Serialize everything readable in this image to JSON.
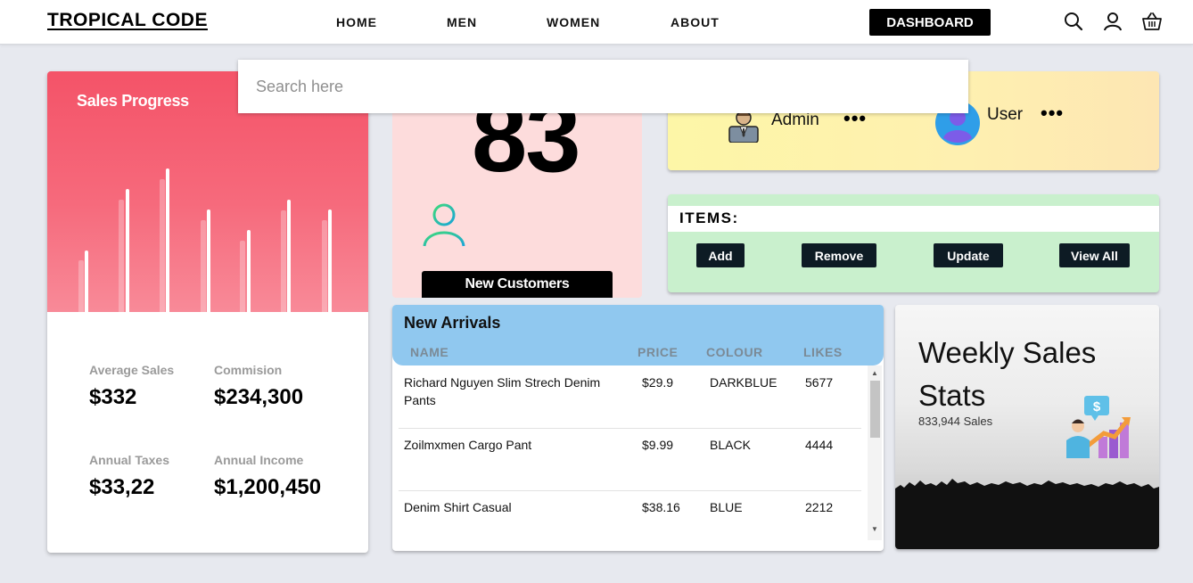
{
  "nav": {
    "brand": "TROPICAL CODE",
    "links": [
      "HOME",
      "MEN",
      "WOMEN",
      "ABOUT"
    ],
    "dashboard": "DASHBOARD",
    "icons": [
      "search-icon",
      "user-icon",
      "basket-icon"
    ]
  },
  "search": {
    "placeholder": "Search here"
  },
  "sales": {
    "title": "Sales Progress",
    "stats": [
      {
        "label": "Average Sales",
        "value": "$332"
      },
      {
        "label": "Commision",
        "value": "$234,300"
      },
      {
        "label": "Annual Taxes",
        "value": "$33,22"
      },
      {
        "label": "Annual Income",
        "value": "$1,200,450"
      }
    ]
  },
  "customers": {
    "count": "83",
    "button": "New Customers"
  },
  "roles": [
    {
      "label": "Admin",
      "icon": "admin-icon",
      "more": "•••"
    },
    {
      "label": "User",
      "icon": "user-avatar-icon",
      "more": "•••"
    }
  ],
  "items": {
    "title": "ITEMS:",
    "buttons": [
      "Add",
      "Remove",
      "Update",
      "View All"
    ]
  },
  "arrivals": {
    "title": "New Arrivals",
    "columns": [
      "NAME",
      "PRICE",
      "COLOUR",
      "LIKES"
    ],
    "rows": [
      {
        "name": "Richard Nguyen Slim Strech Denim Pants",
        "price": "$29.9",
        "colour": "DARKBLUE",
        "likes": "5677"
      },
      {
        "name": "Zoilmxmen Cargo Pant",
        "price": "$9.99",
        "colour": "BLACK",
        "likes": "4444"
      },
      {
        "name": "Denim Shirt Casual",
        "price": "$38.16",
        "colour": "BLUE",
        "likes": "2212"
      }
    ]
  },
  "weekly": {
    "title": "Weekly Sales Stats",
    "sub": "833,944 Sales"
  },
  "colors": {
    "accent": "#f45368",
    "customers_bg": "#fddcdc",
    "roles_bg": "#fdf6a7",
    "items_bg": "#c9f0cd",
    "arrivals_head": "#90c8ef"
  }
}
